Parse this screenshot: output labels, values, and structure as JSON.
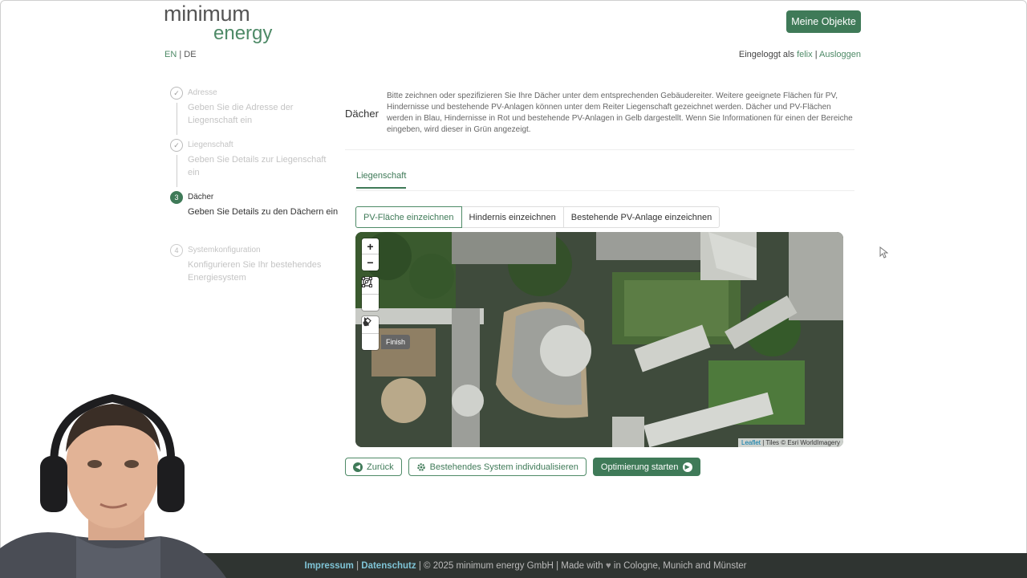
{
  "logo": {
    "line1": "minimum",
    "line2": "energy"
  },
  "header": {
    "objects_button": "Meine Objekte",
    "lang_en": "EN",
    "lang_sep": "|",
    "lang_de": "DE",
    "logged_in_prefix": "Eingeloggt als",
    "username": "felix",
    "separator": "|",
    "logout": "Ausloggen"
  },
  "stepper": {
    "steps": [
      {
        "number": "✓",
        "title": "Adresse",
        "desc": "Geben Sie die Adresse der Liegenschaft ein",
        "state": "done"
      },
      {
        "number": "✓",
        "title": "Liegenschaft",
        "desc": "Geben Sie Details zur Liegenschaft ein",
        "state": "done"
      },
      {
        "number": "3",
        "title": "Dächer",
        "desc": "Geben Sie Details zu den Dächern ein",
        "state": "active"
      },
      {
        "number": "4",
        "title": "Systemkonfiguration",
        "desc": "Konfigurieren Sie Ihr bestehendes Energiesystem",
        "state": "todo"
      }
    ]
  },
  "main": {
    "section_title": "Dächer",
    "info_text": "Bitte zeichnen oder spezifizieren Sie Ihre Dächer unter dem entsprechenden Gebäudereiter. Weitere geeignete Flächen für PV, Hindernisse und bestehende PV-Anlagen können unter dem Reiter Liegenschaft gezeichnet werden. Dächer und PV-Flächen werden in Blau, Hindernisse in Rot und bestehende PV-Anlagen in Gelb dargestellt. Wenn Sie Informationen für einen der Bereiche eingeben, wird dieser in Grün angezeigt.",
    "tab_label": "Liegenschaft",
    "draw_buttons": [
      "PV-Fläche einzeichnen",
      "Hindernis einzeichnen",
      "Bestehende PV-Anlage einzeichnen"
    ]
  },
  "map": {
    "zoom_in": "+",
    "zoom_out": "−",
    "finish_label": "Finish",
    "attribution_link": "Leaflet",
    "attribution_text": "| Tiles © Esri WorldImagery"
  },
  "actions": {
    "back": "Zurück",
    "customize": "Bestehendes System individualisieren",
    "start": "Optimierung starten"
  },
  "footer": {
    "impressum": "Impressum",
    "sep1": "|",
    "datenschutz": "Datenschutz",
    "text_before_heart": "| © 2025 minimum energy GmbH | Made with",
    "heart": "♥",
    "text_after_heart": "in Cologne, Munich and Münster"
  },
  "colors": {
    "accent": "#3f7a58",
    "footer_bg": "#2f3431",
    "link_footer": "#7fc4d6"
  }
}
